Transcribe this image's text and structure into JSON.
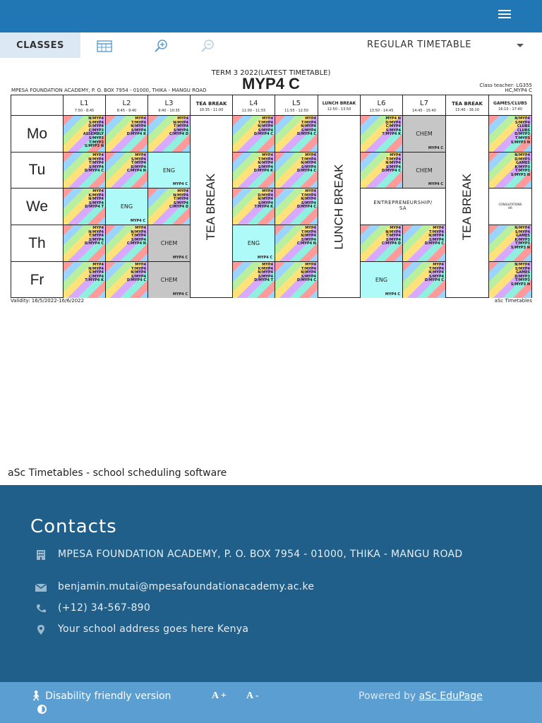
{
  "toolbar": {
    "classes_tab": "CLASSES",
    "timetable_select": "REGULAR TIMETABLE"
  },
  "timetable": {
    "title": "TERM 3 2022(LATEST TIMETABLE)",
    "class_name": "MYP4 C",
    "school": "MPESA FOUNDATION ACADEMY, P. O. BOX 7954 - 01000, THIKA - MANGU ROAD",
    "class_teacher": "Class teacher: LG355",
    "class_code": "HC,MYP4 C",
    "validity": "Validity: 16/5/2022-16/6/2022",
    "generator": "aSc Timetables",
    "periods": [
      {
        "label": "L1",
        "time": "7:50 - 8:45"
      },
      {
        "label": "L2",
        "time": "8:45 - 9:40"
      },
      {
        "label": "L3",
        "time": "9:40 - 10:35"
      },
      {
        "label": "TEA BREAK",
        "time": "10:35 - 11:00"
      },
      {
        "label": "L4",
        "time": "11:00 - 11:55"
      },
      {
        "label": "L5",
        "time": "11:55 - 12:50"
      },
      {
        "label": "LUNCH BREAK",
        "time": "12:50 - 13:50"
      },
      {
        "label": "L6",
        "time": "13:50 - 14:45"
      },
      {
        "label": "L7",
        "time": "14:45 - 15:40"
      },
      {
        "label": "TEA BREAK",
        "time": "15:40 - 16:10"
      },
      {
        "label": "GAMES/CLUBS",
        "time": "16:10 - 17:40"
      }
    ],
    "days": [
      "Mo",
      "Tu",
      "We",
      "Th",
      "Fr"
    ],
    "breaks": {
      "tea1": "TEA BREAK",
      "lunch": "LUNCH BREAK",
      "tea2": "TEA BREAK"
    },
    "lessons": {
      "mo_l1": "N/MYP4\nS/MYP4\nD/MYP4\nC/MYP3\nASSEMBLY\nS/MYP3\nT/MYP3\nS/MYP3 N",
      "mo_l2": "MYP4\nT/MYP4\nN/MYP4\nS/MYP4\nD/MYP4 K",
      "mo_l3": "MYP4\nN/MYP4\nT/MYP4\nS/MYP4\nC/MYP4 D",
      "mo_l4": "MYP4\nT/MYP4\nN/MYP4\nS/MYP4\nD/MYP4 C",
      "mo_l5": "MYP4\nT/MYP4\nN/MYP4\nS/MYP4\nD/MYP4 C",
      "mo_l6": "MYP4 N\nD/MYP4\nC/MYP4\nS/MYP4\nT/MYP4 K",
      "mo_l7": "CHEM",
      "mo_l7_room": "MYP4 C",
      "mo_g": "N/MYP4\nS/MYP4\nCLUBS\nCLUBS\nD/MYP3\nT/MYP3\nS/MYP3 N",
      "tu_l1": "MYP4\nN/MYP4\nT/MYP4\nS/MYP4\nD/MYP4 C",
      "tu_l2": "MYP4\nS/MYP4\nT/MYP4\nD/MYP4\nC/MYP4 N",
      "tu_l3": "ENG",
      "tu_l3_room": "MYP4 C",
      "tu_l4": "MYP4\nT/MYP4\nN/MYP4\nS/MYP4\nD/MYP4 K",
      "tu_l5": "MYP4\nT/MYP4\nN/MYP4\nS/MYP4\nD/MYP4 C",
      "tu_l6": "MYP4\nT/MYP4\nN/MYP4\nS/MYP4\nD/MYP4 C",
      "tu_l7": "CHEM",
      "tu_l7_room": "MYP4 C",
      "tu_g": "N/MYP4\nD/MYP3\nGAMES\nK/MYP3\nT/MYP3\nS/MYP3 N",
      "we_l1": "MYP4\nK/MYP4\nN/MYP4\nS/MYP4\nD/MYP4 T",
      "we_l2": "ENG",
      "we_l2_room": "MYP4 C",
      "we_l3": "MYP4\nN/MYP4\nT/MYP4\nS/MYP4\nC/MYP4 D",
      "we_l4": "MYP4\nD/MYP4\nN/MYP4\nS/MYP4\nT/MYP4 K",
      "we_l5": "MYP4\nT/MYP4\nN/MYP4\nS/MYP4\nD/MYP4 C",
      "we_l6": "ENTREPRENEURSHIP/\nSA",
      "we_g": "CONSULTATIONS\nHR",
      "th_l1": "MYP4\nN/MYP4\nT/MYP4\nS/MYP4\nD/MYP4 C",
      "th_l2": "MYP4\nN/MYP4\nT/MYP4\nS/MYP4\nC/MYP4 N",
      "th_l3": "CHEM",
      "th_l3_room": "MYP4 C",
      "th_l4": "ENG",
      "th_l4_room": "MYP4 C",
      "th_l5": "MYP4\nT/MYP4\nN/MYP4\nS/MYP4\nC/MYP4 N",
      "th_l6": "MYP4\nN/MYP4\nT/MYP4\nS/MYP4\nC/MYP4 D",
      "th_l7": "MYP4\nT/MYP4\nN/MYP4\nS/MYP4\nD/MYP4 C",
      "th_g": "N/MYP4\nS/MYP4\nGAMES\nK/MYP3\nT/MYP3\nS/MYP3 N",
      "fr_l1": "MYP4\nN/MYP4\nS/MYP4\nC/MYP4\nT/MYP4 K",
      "fr_l2": "MYP4\nT/MYP4\nN/MYP4\nS/MYP4\nD/MYP4 C",
      "fr_l3": "CHEM",
      "fr_l3_room": "MYP4 C",
      "fr_l4": "MYP4\nK/MYP4\nN/MYP4\nS/MYP4\nD/MYP4 T",
      "fr_l5": "MYP4\nT/MYP4\nN/MYP4\nS/MYP4\nD/MYP4 C",
      "fr_l6": "ENG",
      "fr_l6_room": "MYP4 C",
      "fr_l7": "MYP4\nT/MYP4\nN/MYP4\nS/MYP4\nD/MYP4 C",
      "fr_g": "N/MYP4\nS/MYP4\nGAMES\nD/MYP3\nT/MYP3\nS/MYP3 N"
    }
  },
  "software_line": "aSc Timetables - school scheduling software",
  "contacts": {
    "heading": "Contacts",
    "address": "MPESA FOUNDATION ACADEMY, P. O. BOX 7954 - 01000, THIKA - MANGU ROAD",
    "email": "benjamin.mutai@mpesafoundationacademy.ac.ke",
    "phone": "(+12) 34-567-890",
    "location": "Your school address goes here Kenya"
  },
  "footer": {
    "disability": "Disability friendly version",
    "font_plus": "A +",
    "font_minus": "A -",
    "powered_prefix": "Powered by",
    "powered_link": "aSc EduPage"
  },
  "icons": [
    "menu-icon",
    "calendar-icon",
    "zoom-in-icon",
    "zoom-out-icon",
    "chevron-down-icon",
    "building-icon",
    "mail-icon",
    "phone-icon",
    "pin-icon",
    "accessibility-icon",
    "contrast-icon"
  ],
  "colors": {
    "topbar": "#2077b3",
    "contacts_bg": "#1f5f8a",
    "bottombar": "#5b9ed1",
    "cyan_cell": "#aefaf8",
    "gray_cell": "#c6c6c6"
  }
}
